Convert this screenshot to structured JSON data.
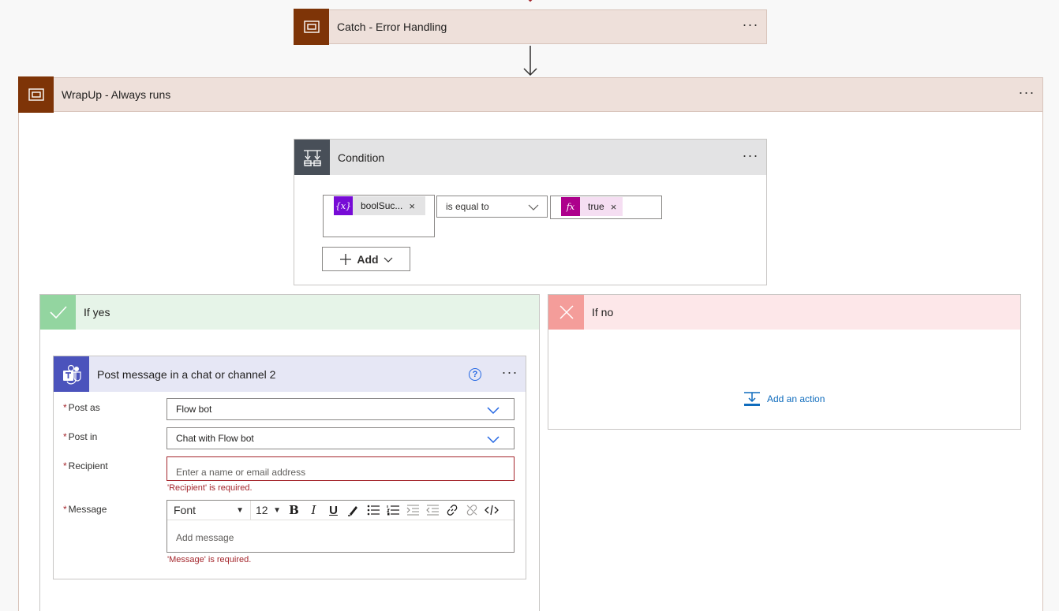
{
  "catch_scope": {
    "title": "Catch - Error Handling",
    "more": "···"
  },
  "wrapup_scope": {
    "title": "WrapUp - Always runs",
    "more": "···"
  },
  "condition": {
    "title": "Condition",
    "more": "···",
    "left_token": "boolSuc...",
    "operator": "is equal to",
    "right_token": "true",
    "add_label": "Add"
  },
  "branch_yes": {
    "title": "If yes"
  },
  "branch_no": {
    "title": "If no",
    "add_action": "Add an action"
  },
  "teams_action": {
    "title": "Post message in a chat or channel 2",
    "more": "···",
    "fields": {
      "post_as": {
        "label": "Post as",
        "value": "Flow bot"
      },
      "post_in": {
        "label": "Post in",
        "value": "Chat with Flow bot"
      },
      "recipient": {
        "label": "Recipient",
        "placeholder": "Enter a name or email address",
        "error": "'Recipient' is required."
      },
      "message": {
        "label": "Message",
        "placeholder": "Add message",
        "error": "'Message' is required."
      }
    },
    "editor": {
      "font": "Font",
      "size": "12"
    }
  },
  "colors": {
    "scope_icon": "#7e3407",
    "scope_header": "#eee0da",
    "condition_icon": "#484f58",
    "yes_icon": "#93d5a0",
    "no_icon": "#f49d9a",
    "teams_icon": "#4b53bc",
    "error": "#a4262c",
    "link": "#0f6cbd"
  }
}
